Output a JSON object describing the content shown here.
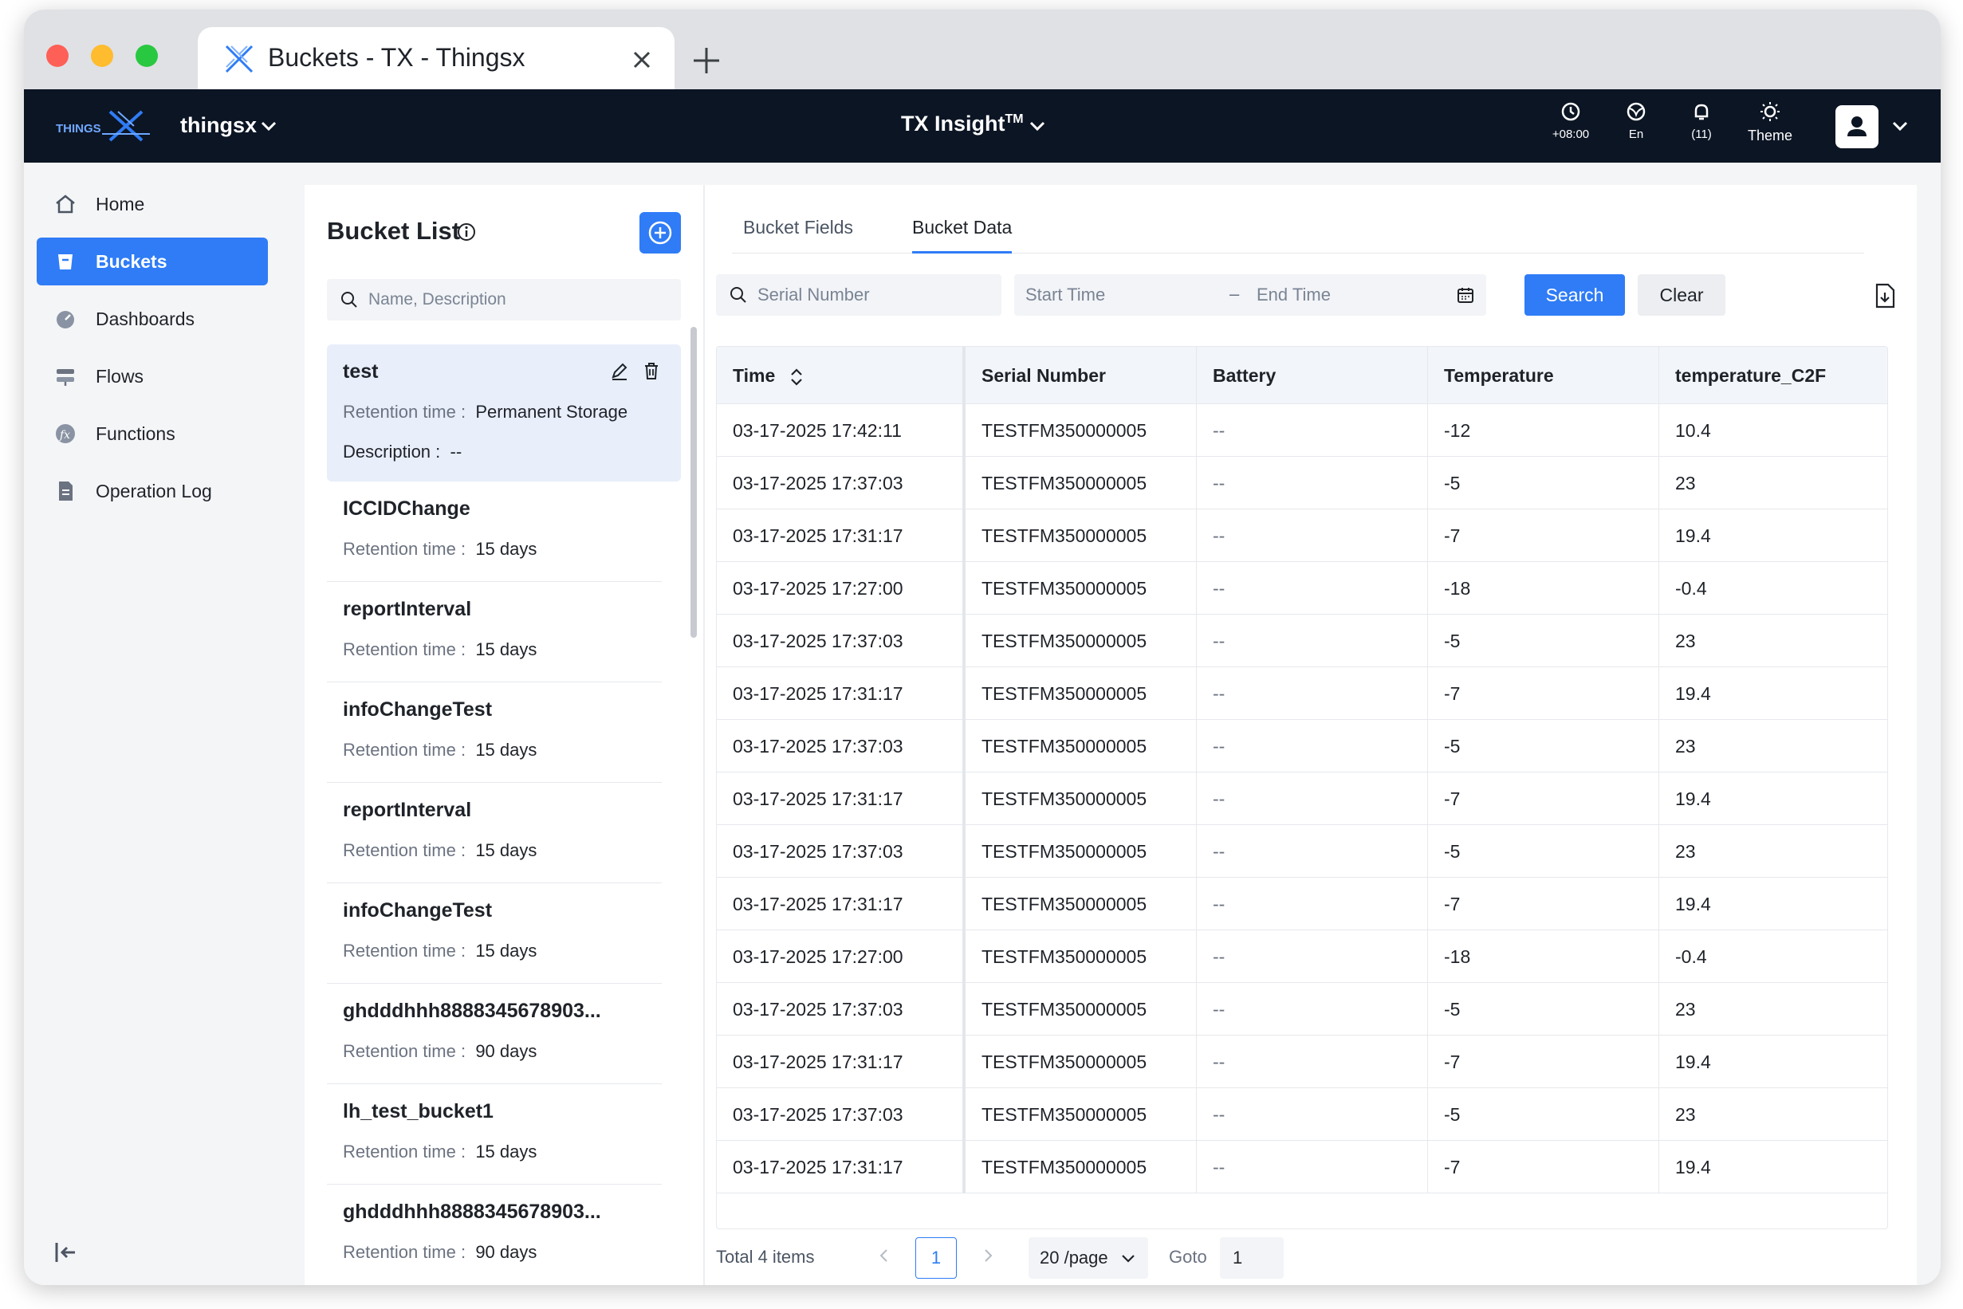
{
  "browser": {
    "tab_title": "Buckets - TX - Thingsx"
  },
  "topnav": {
    "brand": "THINGS",
    "org": "thingsx",
    "product": "TX Insight",
    "product_mark": "TM",
    "timezone": "+08:00",
    "language": "En",
    "notifications": "(11)",
    "theme": "Theme"
  },
  "sidebar": {
    "items": [
      {
        "label": "Home",
        "icon": "home-icon"
      },
      {
        "label": "Buckets",
        "icon": "bucket-icon",
        "active": true
      },
      {
        "label": "Dashboards",
        "icon": "dashboard-icon"
      },
      {
        "label": "Flows",
        "icon": "flow-icon"
      },
      {
        "label": "Functions",
        "icon": "function-icon"
      },
      {
        "label": "Operation Log",
        "icon": "log-icon"
      }
    ]
  },
  "bucket_list": {
    "title": "Bucket List",
    "search_placeholder": "Name, Description",
    "retention_key": "Retention time :",
    "description_key": "Description :",
    "items": [
      {
        "name": "test",
        "retention": "Permanent Storage",
        "description": "--"
      },
      {
        "name": "ICCIDChange",
        "retention": "15 days"
      },
      {
        "name": "reportInterval",
        "retention": "15 days"
      },
      {
        "name": "infoChangeTest",
        "retention": "15 days"
      },
      {
        "name": "reportInterval",
        "retention": "15 days"
      },
      {
        "name": "infoChangeTest",
        "retention": "15 days"
      },
      {
        "name": "ghdddhhh8888345678903...",
        "retention": "90 days"
      },
      {
        "name": "lh_test_bucket1",
        "retention": "15 days"
      },
      {
        "name": "ghdddhhh8888345678903...",
        "retention": "90 days"
      }
    ]
  },
  "data_panel": {
    "tabs": [
      "Bucket Fields",
      "Bucket Data"
    ],
    "active_tab": "Bucket Data",
    "serial_placeholder": "Serial Number",
    "start_placeholder": "Start Time",
    "end_placeholder": "End Time",
    "range_sep": "–",
    "search_label": "Search",
    "clear_label": "Clear",
    "columns": [
      "Time",
      "Serial Number",
      "Battery",
      "Temperature",
      "temperature_C2F"
    ],
    "rows": [
      [
        "03-17-2025 17:42:11",
        "TESTFM350000005",
        "--",
        "-12",
        "10.4"
      ],
      [
        "03-17-2025 17:37:03",
        "TESTFM350000005",
        "--",
        "-5",
        "23"
      ],
      [
        "03-17-2025 17:31:17",
        "TESTFM350000005",
        "--",
        "-7",
        "19.4"
      ],
      [
        "03-17-2025 17:27:00",
        "TESTFM350000005",
        "--",
        "-18",
        "-0.4"
      ],
      [
        "03-17-2025 17:37:03",
        "TESTFM350000005",
        "--",
        "-5",
        "23"
      ],
      [
        "03-17-2025 17:31:17",
        "TESTFM350000005",
        "--",
        "-7",
        "19.4"
      ],
      [
        "03-17-2025 17:37:03",
        "TESTFM350000005",
        "--",
        "-5",
        "23"
      ],
      [
        "03-17-2025 17:31:17",
        "TESTFM350000005",
        "--",
        "-7",
        "19.4"
      ],
      [
        "03-17-2025 17:37:03",
        "TESTFM350000005",
        "--",
        "-5",
        "23"
      ],
      [
        "03-17-2025 17:31:17",
        "TESTFM350000005",
        "--",
        "-7",
        "19.4"
      ],
      [
        "03-17-2025 17:27:00",
        "TESTFM350000005",
        "--",
        "-18",
        "-0.4"
      ],
      [
        "03-17-2025 17:37:03",
        "TESTFM350000005",
        "--",
        "-5",
        "23"
      ],
      [
        "03-17-2025 17:31:17",
        "TESTFM350000005",
        "--",
        "-7",
        "19.4"
      ],
      [
        "03-17-2025 17:37:03",
        "TESTFM350000005",
        "--",
        "-5",
        "23"
      ],
      [
        "03-17-2025 17:31:17",
        "TESTFM350000005",
        "--",
        "-7",
        "19.4"
      ]
    ],
    "pagination": {
      "total": "Total 4 items",
      "current_page": "1",
      "page_size": "20 /page",
      "goto_label": "Goto",
      "goto_value": "1"
    }
  },
  "colors": {
    "accent": "#2f7cf6",
    "nav_bg": "#0c1524"
  }
}
